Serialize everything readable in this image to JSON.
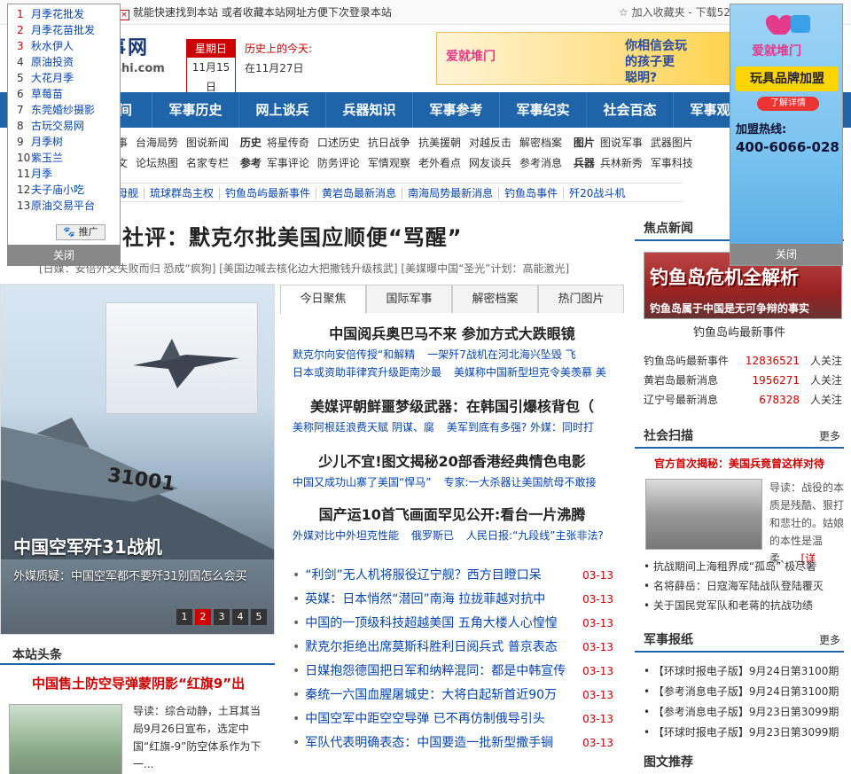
{
  "topbar": {
    "message": "就能快速找到本站 或者收藏本站网址方便下次登录本站",
    "favorite": "加入收藏夹",
    "download": "下载52"
  },
  "header": {
    "logo_name": "事网",
    "logo_url": "nshi.com",
    "weekday": "星期日",
    "date": "11月15日",
    "history_title": "历史上的今天:",
    "history_date": "在11月27日"
  },
  "banner": {
    "brand": "爱就堆门",
    "slogan_line1": "你相信会玩",
    "slogan_line2": "的孩子更",
    "slogan_line3": "聪明?"
  },
  "nav": [
    "间",
    "军事历史",
    "网上谈兵",
    "兵器知识",
    "军事参考",
    "军事纪实",
    "社会百态",
    "军事观察"
  ],
  "subnav": {
    "row1_a": [
      "军事",
      "台海局势",
      "图说新闻"
    ],
    "row1_b_head": "历史",
    "row1_b": [
      "将星传奇",
      "口述历史",
      "抗日战争",
      "抗美援朝",
      "对越反击",
      "解密档案"
    ],
    "row1_c_head": "图片",
    "row1_c": [
      "图说军事",
      "武器图片"
    ],
    "row2_a": [
      "博文",
      "论坛热图",
      "名家专栏"
    ],
    "row2_b_head": "参考",
    "row2_b": [
      "军事评论",
      "防务评论",
      "军情观察",
      "老外看点",
      "网友谈兵",
      "参考消息"
    ],
    "row2_c_head": "兵器",
    "row2_c": [
      "兵林新秀",
      "军事科技"
    ]
  },
  "hotbar": [
    "空母舰",
    "琉球群岛主权",
    "钓鱼岛屿最新事件",
    "黄岩岛最新消息",
    "南海局势最新消息",
    "钓鱼岛事件",
    "歼20战斗机"
  ],
  "headline": {
    "title": "社评：默克尔批美国应顺便“骂醒”",
    "subheads": "[日媒：安倍外交失败而归 恐成“疯狗]  [美国边喊去核化边大把撒钱升级核武]  [美媒曝中国“圣光”计划：高能激光]"
  },
  "slider": {
    "caption_title": "中国空军歼31战机",
    "caption_sub": "外媒质疑：中国空军都不要歼31别国怎么会买",
    "tail_number": "31001",
    "pages": [
      "1",
      "2",
      "3",
      "4",
      "5"
    ],
    "active_page": "2"
  },
  "tabs": [
    "今日聚焦",
    "国际军事",
    "解密档案",
    "热门图片"
  ],
  "focus_news": [
    {
      "big": "中国阅兵奥巴马不来 参加方式大跌眼镜",
      "links1": [
        "默克尔向安倍传授“和解精",
        "一架歼7战机在河北海兴坠毁 飞"
      ],
      "links2": [
        "日本或资助菲律宾升级距南沙最",
        "美媒称中国新型坦克令美羡慕 美"
      ]
    },
    {
      "big": "美媒评朝鲜噩梦级武器：在韩国引爆核背包（",
      "links1": [
        "美称阿根廷浪费天赋 阴谋、腐",
        "美军到底有多强? 外媒：同时打"
      ]
    },
    {
      "big": "少儿不宜!图文揭秘20部香港经典情色电影",
      "links1": [
        "中国又成功山寨了美国“悍马”",
        "专家:一大杀器让美国航母不敢接"
      ]
    },
    {
      "big": "国产运10首飞画面罕见公开:看台一片沸腾",
      "links1": [
        "外媒对比中外坦克性能",
        "俄罗斯已",
        "人民日报:“九段线”主张非法?"
      ]
    }
  ],
  "news_list": [
    {
      "text": "“利剑”无人机将服役辽宁舰？西方目瞪口呆",
      "date": "03-13"
    },
    {
      "text": "英媒：日本悄然“潜回”南海 拉拢菲越对抗中",
      "date": "03-13"
    },
    {
      "text": "中国的一顶级科技超越美国 五角大楼人心惶惶",
      "date": "03-13"
    },
    {
      "text": "默克尔拒绝出席莫斯科胜利日阅兵式 普京表态",
      "date": "03-13"
    },
    {
      "text": "日媒抱怨德国把日军和纳粹混同：都是中韩宣传",
      "date": "03-13"
    },
    {
      "text": "秦统一六国血腥屠城史：大将白起斩首近90万",
      "date": "03-13"
    },
    {
      "text": "中国空军中距空空导弹 已不再仿制俄导引头",
      "date": "03-13"
    },
    {
      "text": "军队代表明确表态：中国要造一批新型撒手锏",
      "date": "03-13"
    }
  ],
  "site_head": {
    "label": "本站头条",
    "title": "中国售土防空导弹蒙阴影“红旗9”出",
    "text": "导读：综合动静，土耳其当局9月26日宣布，选定中国“红旗-9”防空体系作为下一..."
  },
  "focus_box": {
    "label": "焦点新闻",
    "img_title": "钓鱼岛危机全解析",
    "img_sub": "钓鱼岛属于中国是无可争辩的事实",
    "caption": "钓鱼岛屿最新事件",
    "rows": [
      {
        "name": "钓鱼岛屿最新事件",
        "count": "12836521",
        "unit": "人关注"
      },
      {
        "name": "黄岩岛最新消息",
        "count": "1956271",
        "unit": "人关注"
      },
      {
        "name": "辽宁号最新消息",
        "count": "678328",
        "unit": "人关注"
      }
    ]
  },
  "social_box": {
    "label": "社会扫描",
    "more": "更多",
    "title": "官方首次揭秘：美国兵竟曾这样对待",
    "text": "导读：战役的本质是残酷、狠打和悲壮的。姑娘的本性是温柔、...",
    "more_link": "[详",
    "list": [
      "抗战期间上海租界成“孤岛” 极尽奢",
      "名将薛岳：日寇海军陆战队登陆覆灭",
      "关于国民党军队和老蒋的抗战功绩"
    ]
  },
  "paper_box": {
    "label": "军事报纸",
    "more": "更多",
    "list": [
      "【环球时报电子版】9月24日第3100期",
      "【参考消息电子版】9月24日第3100期",
      "【参考消息电子版】9月23日第3099期",
      "【环球时报电子版】9月23日第3099期"
    ]
  },
  "picture_box": {
    "label": "图文推荐"
  },
  "left_popup": {
    "items": [
      {
        "num": "1",
        "label": "月季花批发"
      },
      {
        "num": "2",
        "label": "月季花苗批发"
      },
      {
        "num": "3",
        "label": "秋水伊人"
      },
      {
        "num": "4",
        "label": "原油投资"
      },
      {
        "num": "5",
        "label": "大花月季"
      },
      {
        "num": "6",
        "label": "草莓苗"
      },
      {
        "num": "7",
        "label": "东莞婚纱摄影"
      },
      {
        "num": "8",
        "label": "古玩交易网"
      },
      {
        "num": "9",
        "label": "月季树"
      },
      {
        "num": "10",
        "label": "紫玉兰"
      },
      {
        "num": "11",
        "label": "月季"
      },
      {
        "num": "12",
        "label": "夫子庙小吃"
      },
      {
        "num": "13",
        "label": "原油交易平台"
      }
    ],
    "ad_tag": "推广",
    "close": "关闭"
  },
  "right_popup": {
    "brand": "爱就堆门",
    "plate": "玩具品牌加盟",
    "btn": "了解详情",
    "hotline": "加盟热线:",
    "tel": "400-6066-028",
    "close": "关闭"
  }
}
